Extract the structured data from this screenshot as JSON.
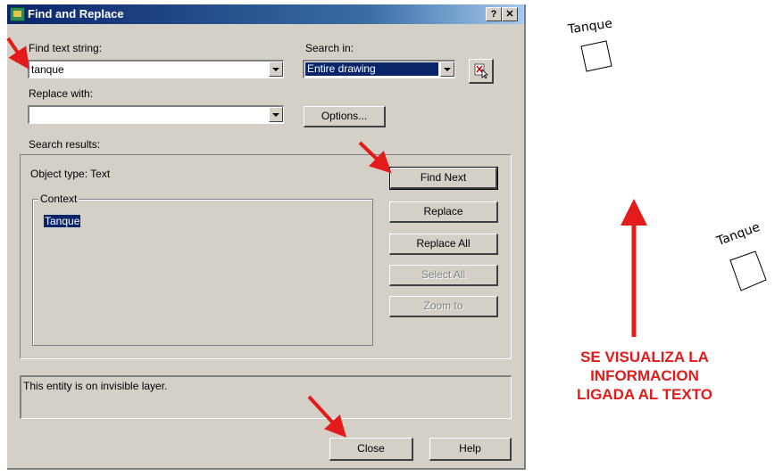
{
  "dialog": {
    "title": "Find and Replace",
    "help_glyph": "?",
    "close_glyph": "✕"
  },
  "find": {
    "label": "Find text string:",
    "value": "tanque"
  },
  "replace": {
    "label": "Replace with:",
    "value": ""
  },
  "search_in": {
    "label": "Search in:",
    "value": "Entire drawing"
  },
  "buttons": {
    "options": "Options...",
    "find_next": "Find Next",
    "replace": "Replace",
    "replace_all": "Replace All",
    "select_all": "Select All",
    "zoom_to": "Zoom to",
    "close": "Close",
    "help": "Help"
  },
  "results": {
    "label": "Search results:",
    "object_type": "Object type: Text",
    "context_label": "Context",
    "context_value": "Tanque",
    "status": "This entity is on invisible layer."
  },
  "drawing": {
    "text1": "Tanque",
    "text2": "Tanque"
  },
  "annotation": {
    "line1": "SE VISUALIZA LA",
    "line2": "INFORMACION",
    "line3": "LIGADA AL TEXTO"
  },
  "colors": {
    "accent_red": "#e31b1b",
    "title_blue": "#0a246a",
    "dialog_bg": "#d4d0c8"
  }
}
